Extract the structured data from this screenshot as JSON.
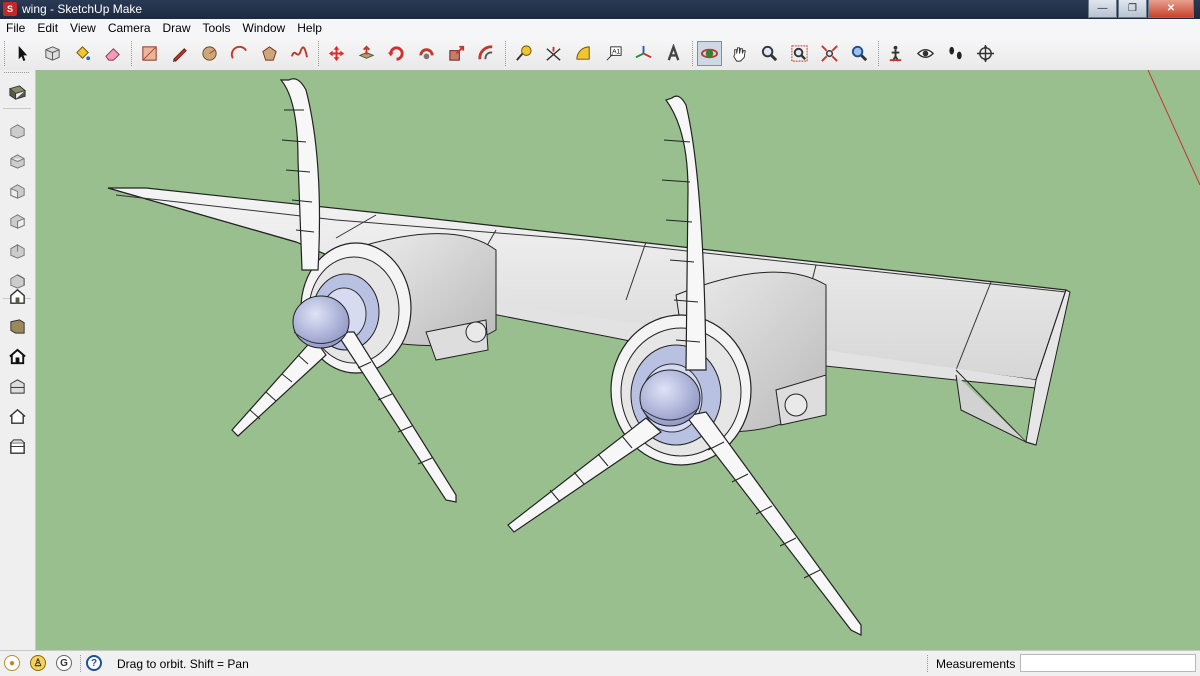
{
  "window": {
    "title": "wing - SketchUp Make",
    "app_icon": "sketchup-icon"
  },
  "menu": [
    "File",
    "Edit",
    "View",
    "Camera",
    "Draw",
    "Tools",
    "Window",
    "Help"
  ],
  "toolbar": {
    "active_tool": "orbit",
    "tools": [
      "select",
      "make-component",
      "paint-bucket",
      "eraser",
      "rectangle",
      "line",
      "circle",
      "arc",
      "polygon",
      "freehand",
      "move",
      "push-pull",
      "rotate",
      "follow-me",
      "scale",
      "offset",
      "tape-measure",
      "dimension",
      "protractor",
      "text",
      "axes",
      "3d-text",
      "orbit",
      "pan",
      "zoom",
      "zoom-window",
      "zoom-extents",
      "previous",
      "position-camera",
      "look-around",
      "walk",
      "section-plane"
    ]
  },
  "sidebar": {
    "tools": [
      "get-models",
      "iso-view",
      "top-view",
      "front-view",
      "right-view",
      "back-view",
      "left-view",
      "add-location",
      "preview-in-google-earth",
      "view-house",
      "warehouse-share",
      "home-outline",
      "store-component"
    ]
  },
  "status": {
    "hint": "Drag to orbit.  Shift = Pan",
    "measurements_label": "Measurements",
    "measurements_value": ""
  },
  "colors": {
    "viewport_background": "#99bf8f",
    "model_surface": "#e8e8e8",
    "spinner_hub": "#a9b0d8",
    "red_axis": "#c0392b"
  }
}
